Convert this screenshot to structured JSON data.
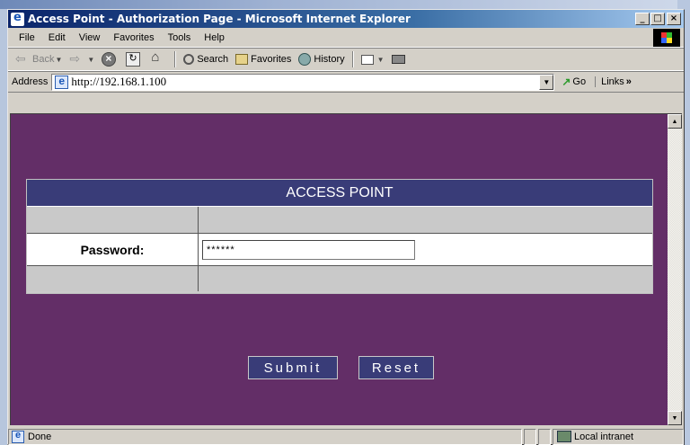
{
  "window": {
    "title": "Access Point - Authorization Page - Microsoft Internet Explorer",
    "controls": {
      "minimize": "_",
      "maximize": "□",
      "close": "×"
    }
  },
  "menu": [
    "File",
    "Edit",
    "View",
    "Favorites",
    "Tools",
    "Help"
  ],
  "toolbar": {
    "back": "Back",
    "search": "Search",
    "favorites": "Favorites",
    "history": "History"
  },
  "address": {
    "label": "Address",
    "url": "http://192.168.1.100",
    "go": "Go",
    "links": "Links"
  },
  "page": {
    "table_title": "ACCESS POINT",
    "password_label": "Password:",
    "password_value": "******",
    "submit_label": "Submit",
    "reset_label": "Reset"
  },
  "status": {
    "text": "Done",
    "zone": "Local intranet"
  },
  "colors": {
    "page_background": "#632e67",
    "header_background": "#393c78",
    "titlebar_start": "#0a246a",
    "titlebar_end": "#a6caf0"
  }
}
